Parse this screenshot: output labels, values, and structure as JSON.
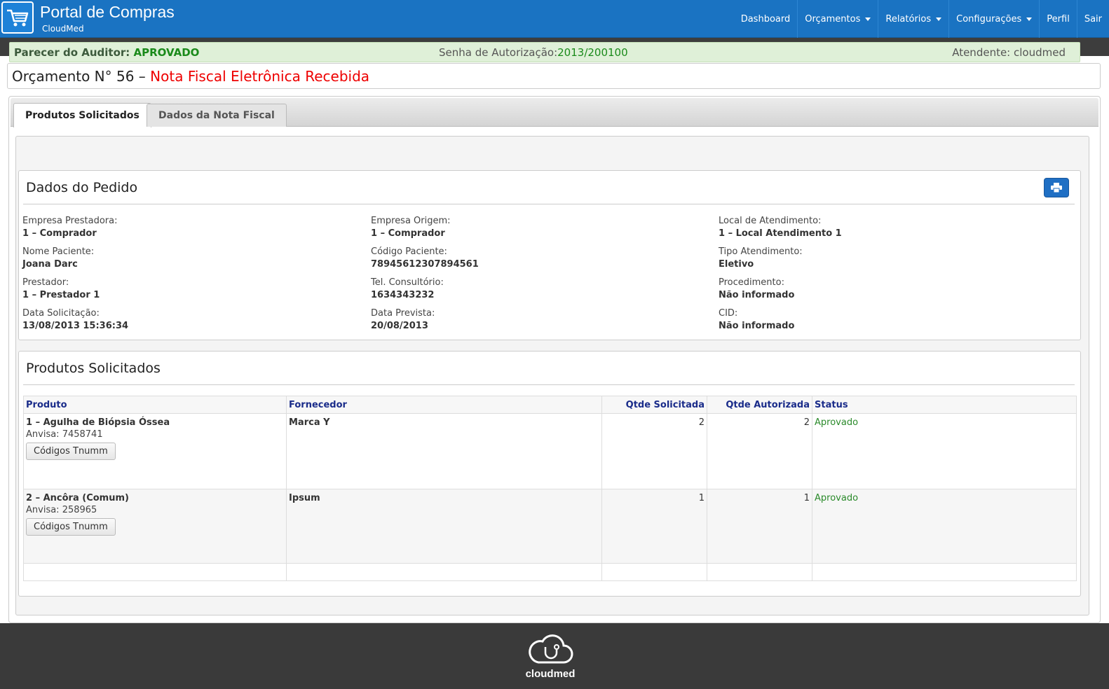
{
  "header": {
    "title": "Portal de Compras",
    "subtitle": "CloudMed",
    "nav": [
      {
        "label": "Dashboard",
        "dropdown": false
      },
      {
        "label": "Orçamentos",
        "dropdown": true
      },
      {
        "label": "Relatórios",
        "dropdown": true
      },
      {
        "label": "Configurações",
        "dropdown": true
      },
      {
        "label": "Perfil",
        "dropdown": false
      },
      {
        "label": "Sair",
        "dropdown": false
      }
    ]
  },
  "page": {
    "title_prefix": "Orçamento N° ",
    "number": "56",
    "title_sep": " – ",
    "status_title": "Nota Fiscal Eletrônica Recebida",
    "status_color": "#e00000"
  },
  "tabs": [
    {
      "label": "Produtos Solicitados",
      "active": true
    },
    {
      "label": "Dados da Nota Fiscal",
      "active": false
    }
  ],
  "auditor": {
    "label": "Parecer do Auditor: ",
    "value": "APROVADO",
    "senha_label": "Senha de Autorização:",
    "senha_value": "2013/200100",
    "atendente": "Atendente: cloudmed"
  },
  "pedido": {
    "title": "Dados do Pedido",
    "print_icon": "printer-icon",
    "fields": [
      {
        "label": "Empresa Prestadora:",
        "value": "1 – Comprador"
      },
      {
        "label": "Empresa Origem:",
        "value": "1 – Comprador"
      },
      {
        "label": "Local de Atendimento:",
        "value": "1 – Local Atendimento 1"
      },
      {
        "label": "Nome Paciente:",
        "value": "Joana Darc"
      },
      {
        "label": "Código Paciente:",
        "value": "78945612307894561"
      },
      {
        "label": "Tipo Atendimento:",
        "value": "Eletivo"
      },
      {
        "label": "Prestador:",
        "value": "1 – Prestador 1"
      },
      {
        "label": "Tel. Consultório:",
        "value": "1634343232"
      },
      {
        "label": "Procedimento:",
        "value": "Não informado"
      },
      {
        "label": "Data Solicitação:",
        "value": "13/08/2013 15:36:34"
      },
      {
        "label": "Data Prevista:",
        "value": "20/08/2013"
      },
      {
        "label": "CID:",
        "value": "Não informado"
      }
    ]
  },
  "produtos": {
    "title": "Produtos Solicitados",
    "columns": [
      "Produto",
      "Fornecedor",
      "Qtde Solicitada",
      "Qtde Autorizada",
      "Status"
    ],
    "rows": [
      {
        "produto": "1 – Agulha de Biópsia Óssea",
        "anvisa": "Anvisa: 7458741",
        "button": "Códigos Tnumm",
        "fornecedor": "Marca Y",
        "solicitada": "2",
        "autorizada": "2",
        "status": "Aprovado"
      },
      {
        "produto": "2 – Ancôra (Comum)",
        "anvisa": "Anvisa: 258965",
        "button": "Códigos Tnumm",
        "fornecedor": "Ipsum",
        "solicitada": "1",
        "autorizada": "1",
        "status": "Aprovado"
      }
    ]
  },
  "footer": {
    "logo_text": "cloudmed",
    "logo_icon": "cloud-stethoscope-icon"
  }
}
